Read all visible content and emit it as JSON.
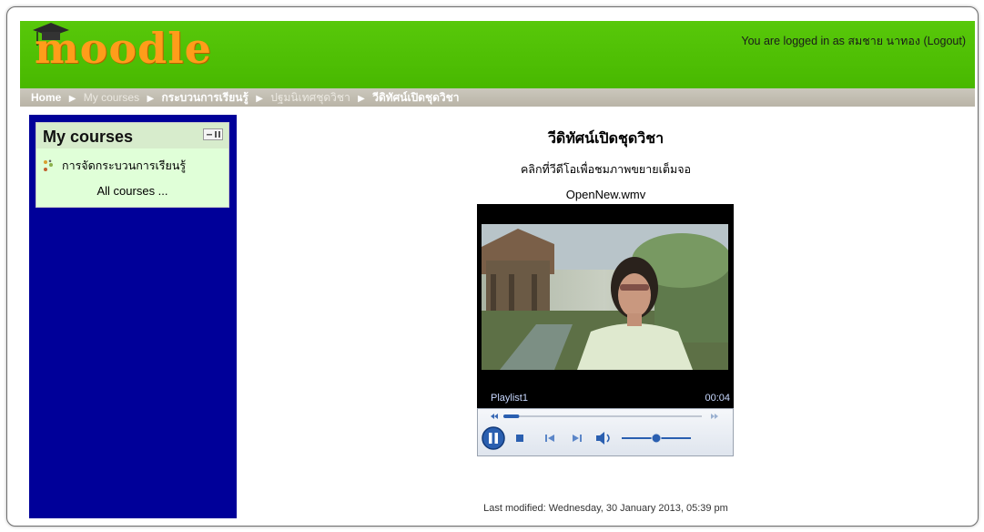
{
  "header": {
    "logo_text": "moodle",
    "login_text": "You are logged in as สมชาย นาทอง (Logout)",
    "brand_color": "#50c000"
  },
  "breadcrumb": {
    "items": [
      {
        "label": "Home",
        "style": "bold"
      },
      {
        "label": "My courses",
        "style": "dim"
      },
      {
        "label": "กระบวนการเรียนรู้",
        "style": "bold"
      },
      {
        "label": "ปฐมนิเทศชุดวิชา",
        "style": "dim"
      },
      {
        "label": "วีดิทัศน์เปิดชุดวิชา",
        "style": "bold"
      }
    ]
  },
  "sidebar": {
    "block_title": "My courses",
    "course_item": "การจัดกระบวนการเรียนรู้",
    "all_courses": "All courses ...",
    "background_color": "#000099"
  },
  "main": {
    "title": "วีดิทัศน์เปิดชุดวิชา",
    "instruction": "คลิกที่วีดีโอเพื่อชมภาพขยายเต็มจอ",
    "filename": "OpenNew.wmv",
    "player": {
      "playlist": "Playlist1",
      "time": "00:04",
      "progress": 0.08,
      "volume": 0.5,
      "state": "playing"
    },
    "footer": "Last modified: Wednesday, 30 January 2013, 05:39 pm"
  },
  "icons": [
    "graduation-cap-icon",
    "block-toggle-icon",
    "course-icon",
    "rewind-icon",
    "fast-forward-icon",
    "pause-icon",
    "stop-icon",
    "previous-icon",
    "next-icon",
    "volume-icon"
  ]
}
